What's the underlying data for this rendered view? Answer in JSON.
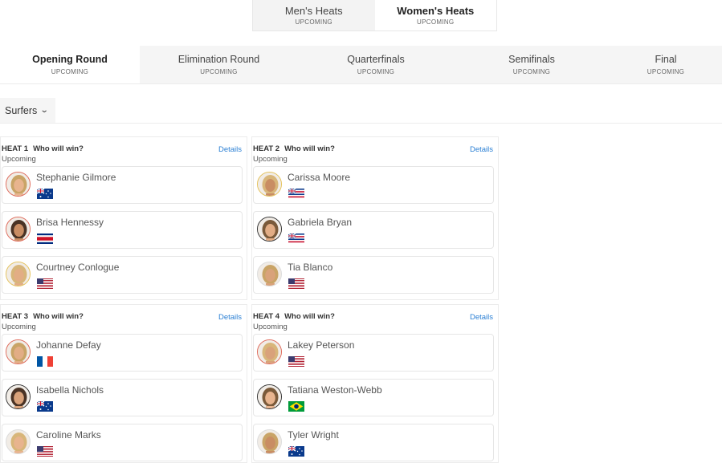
{
  "gender_tabs": [
    {
      "label": "Men's Heats",
      "status": "UPCOMING"
    },
    {
      "label": "Women's Heats",
      "status": "UPCOMING"
    }
  ],
  "rounds": [
    {
      "label": "Opening Round",
      "status": "UPCOMING"
    },
    {
      "label": "Elimination Round",
      "status": "UPCOMING"
    },
    {
      "label": "Quarterfinals",
      "status": "UPCOMING"
    },
    {
      "label": "Semifinals",
      "status": "UPCOMING"
    },
    {
      "label": "Final",
      "status": "UPCOMING"
    }
  ],
  "filter": {
    "label": "Surfers",
    "icon": "chevron-down-icon"
  },
  "heats": [
    {
      "heat_label": "HEAT 1",
      "question": "Who will win?",
      "status": "Upcoming",
      "details": "Details",
      "surfers": [
        {
          "name": "Stephanie Gilmore",
          "flag": "australia"
        },
        {
          "name": "Brisa Hennessy",
          "flag": "costa-rica"
        },
        {
          "name": "Courtney Conlogue",
          "flag": "usa"
        }
      ]
    },
    {
      "heat_label": "HEAT 2",
      "question": "Who will win?",
      "status": "Upcoming",
      "details": "Details",
      "surfers": [
        {
          "name": "Carissa Moore",
          "flag": "hawaii"
        },
        {
          "name": "Gabriela Bryan",
          "flag": "hawaii"
        },
        {
          "name": "Tia Blanco",
          "flag": "usa"
        }
      ]
    },
    {
      "heat_label": "HEAT 3",
      "question": "Who will win?",
      "status": "Upcoming",
      "details": "Details",
      "surfers": [
        {
          "name": "Johanne Defay",
          "flag": "france"
        },
        {
          "name": "Isabella Nichols",
          "flag": "australia"
        },
        {
          "name": "Caroline Marks",
          "flag": "usa"
        }
      ]
    },
    {
      "heat_label": "HEAT 4",
      "question": "Who will win?",
      "status": "Upcoming",
      "details": "Details",
      "surfers": [
        {
          "name": "Lakey Peterson",
          "flag": "usa"
        },
        {
          "name": "Tatiana Weston-Webb",
          "flag": "brazil"
        },
        {
          "name": "Tyler Wright",
          "flag": "australia"
        }
      ]
    }
  ]
}
